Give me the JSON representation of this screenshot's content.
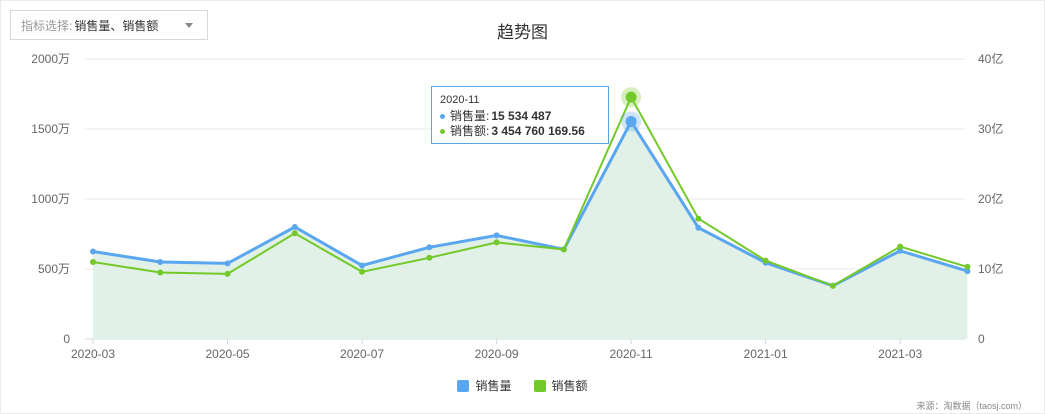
{
  "selector": {
    "label": "指标选择:",
    "value": "销售量、销售额"
  },
  "chart_data": {
    "type": "line",
    "title": "趋势图",
    "x": [
      "2020-03",
      "2020-04",
      "2020-05",
      "2020-06",
      "2020-07",
      "2020-08",
      "2020-09",
      "2020-10",
      "2020-11",
      "2020-12",
      "2021-01",
      "2021-02",
      "2021-03",
      "2021-04"
    ],
    "xticks": [
      "2020-03",
      "2020-05",
      "2020-07",
      "2020-09",
      "2020-11",
      "2021-01",
      "2021-03"
    ],
    "y_left": {
      "ticks": [
        "0",
        "500万",
        "1000万",
        "1500万",
        "2000万"
      ],
      "min": 0,
      "max": 20000000
    },
    "y_right": {
      "ticks": [
        "0",
        "10亿",
        "20亿",
        "30亿",
        "40亿"
      ],
      "min": 0,
      "max": 4000000000
    },
    "series": [
      {
        "name": "销售量",
        "axis": "left",
        "color": "#5aa6ef",
        "values": [
          6250000,
          5500000,
          5400000,
          8000000,
          5250000,
          6550000,
          7400000,
          6400000,
          15534487,
          7950000,
          5450000,
          3800000,
          6300000,
          4850000
        ]
      },
      {
        "name": "销售额",
        "axis": "right",
        "color": "#73c92a",
        "values": [
          1100000000,
          950000000,
          930000000,
          1510000000,
          960000000,
          1160000000,
          1380000000,
          1280000000,
          3454760169.56,
          1720000000,
          1120000000,
          760000000,
          1320000000,
          1030000000
        ]
      }
    ],
    "area_fill": "#e2f1e7",
    "grid": true,
    "legend_position": "bottom"
  },
  "tooltip": {
    "date": "2020-11",
    "rows": [
      {
        "label": "销售量:",
        "value": "15 534 487",
        "color": "#5aa6ef"
      },
      {
        "label": "销售额:",
        "value": "3 454 760 169.56",
        "color": "#73c92a"
      }
    ]
  },
  "legend": [
    {
      "label": "销售量",
      "color": "#5aa6ef"
    },
    {
      "label": "销售额",
      "color": "#73c92a"
    }
  ],
  "source": "来源：淘数据（taosj.com）"
}
